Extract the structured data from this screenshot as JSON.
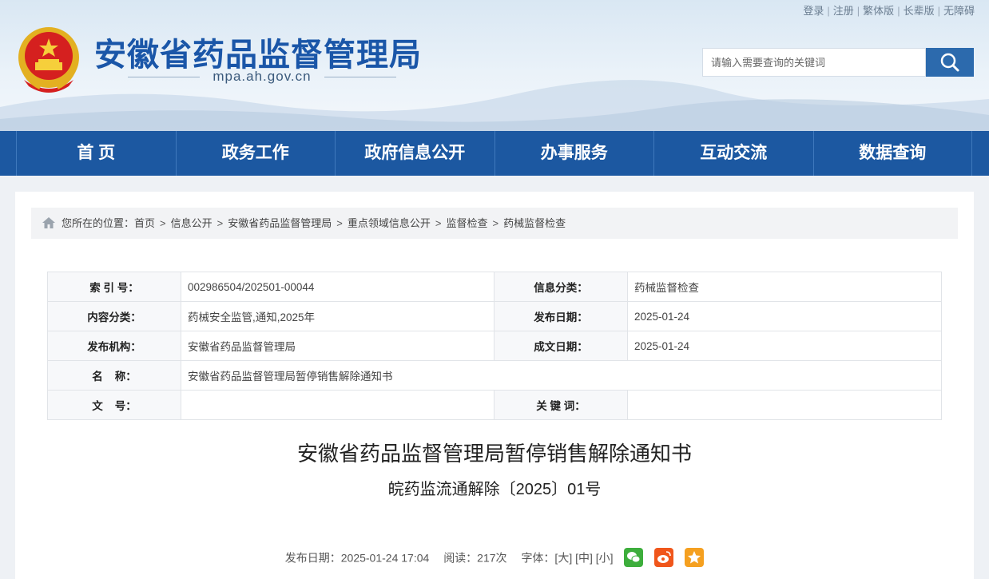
{
  "header": {
    "top_links": [
      "登录",
      "注册",
      "繁体版",
      "长辈版",
      "无障碍"
    ],
    "site_title": "安徽省药品监督管理局",
    "site_domain": "mpa.ah.gov.cn",
    "search_placeholder": "请输入需要查询的关键词"
  },
  "nav": [
    "首 页",
    "政务工作",
    "政府信息公开",
    "办事服务",
    "互动交流",
    "数据查询"
  ],
  "breadcrumb": {
    "prefix": "您所在的位置：",
    "items": [
      "首页",
      "信息公开",
      "安徽省药品监督管理局",
      "重点领域信息公开",
      "监督检查",
      "药械监督检查"
    ]
  },
  "meta": {
    "index_label": "索 引 号：",
    "index_value": "002986504/202501-00044",
    "category_label": "信息分类：",
    "category_value": "药械监督检查",
    "content_label": "内容分类：",
    "content_value": "药械安全监管,通知,2025年",
    "pubdate_label": "发布日期：",
    "pubdate_value": "2025-01-24",
    "org_label": "发布机构：",
    "org_value": "安徽省药品监督管理局",
    "created_label": "成文日期：",
    "created_value": "2025-01-24",
    "name_label": "名    称：",
    "name_value": "安徽省药品监督管理局暂停销售解除通知书",
    "docno_label": "文    号：",
    "docno_value": "",
    "keywords_label": "关 键 词：",
    "keywords_value": ""
  },
  "article": {
    "title": "安徽省药品监督管理局暂停销售解除通知书",
    "doc_number": "皖药监流通解除〔2025〕01号",
    "pub_info": "发布日期：2025-01-24 17:04",
    "reads": "阅读：217次",
    "font_label": "字体：[大] [中] [小]"
  },
  "colors": {
    "nav_bg": "#1c58a1",
    "title_blue": "#1a56a8",
    "wechat": "#3dae3c",
    "weibo": "#f0561b",
    "favorite": "#f5a020"
  }
}
